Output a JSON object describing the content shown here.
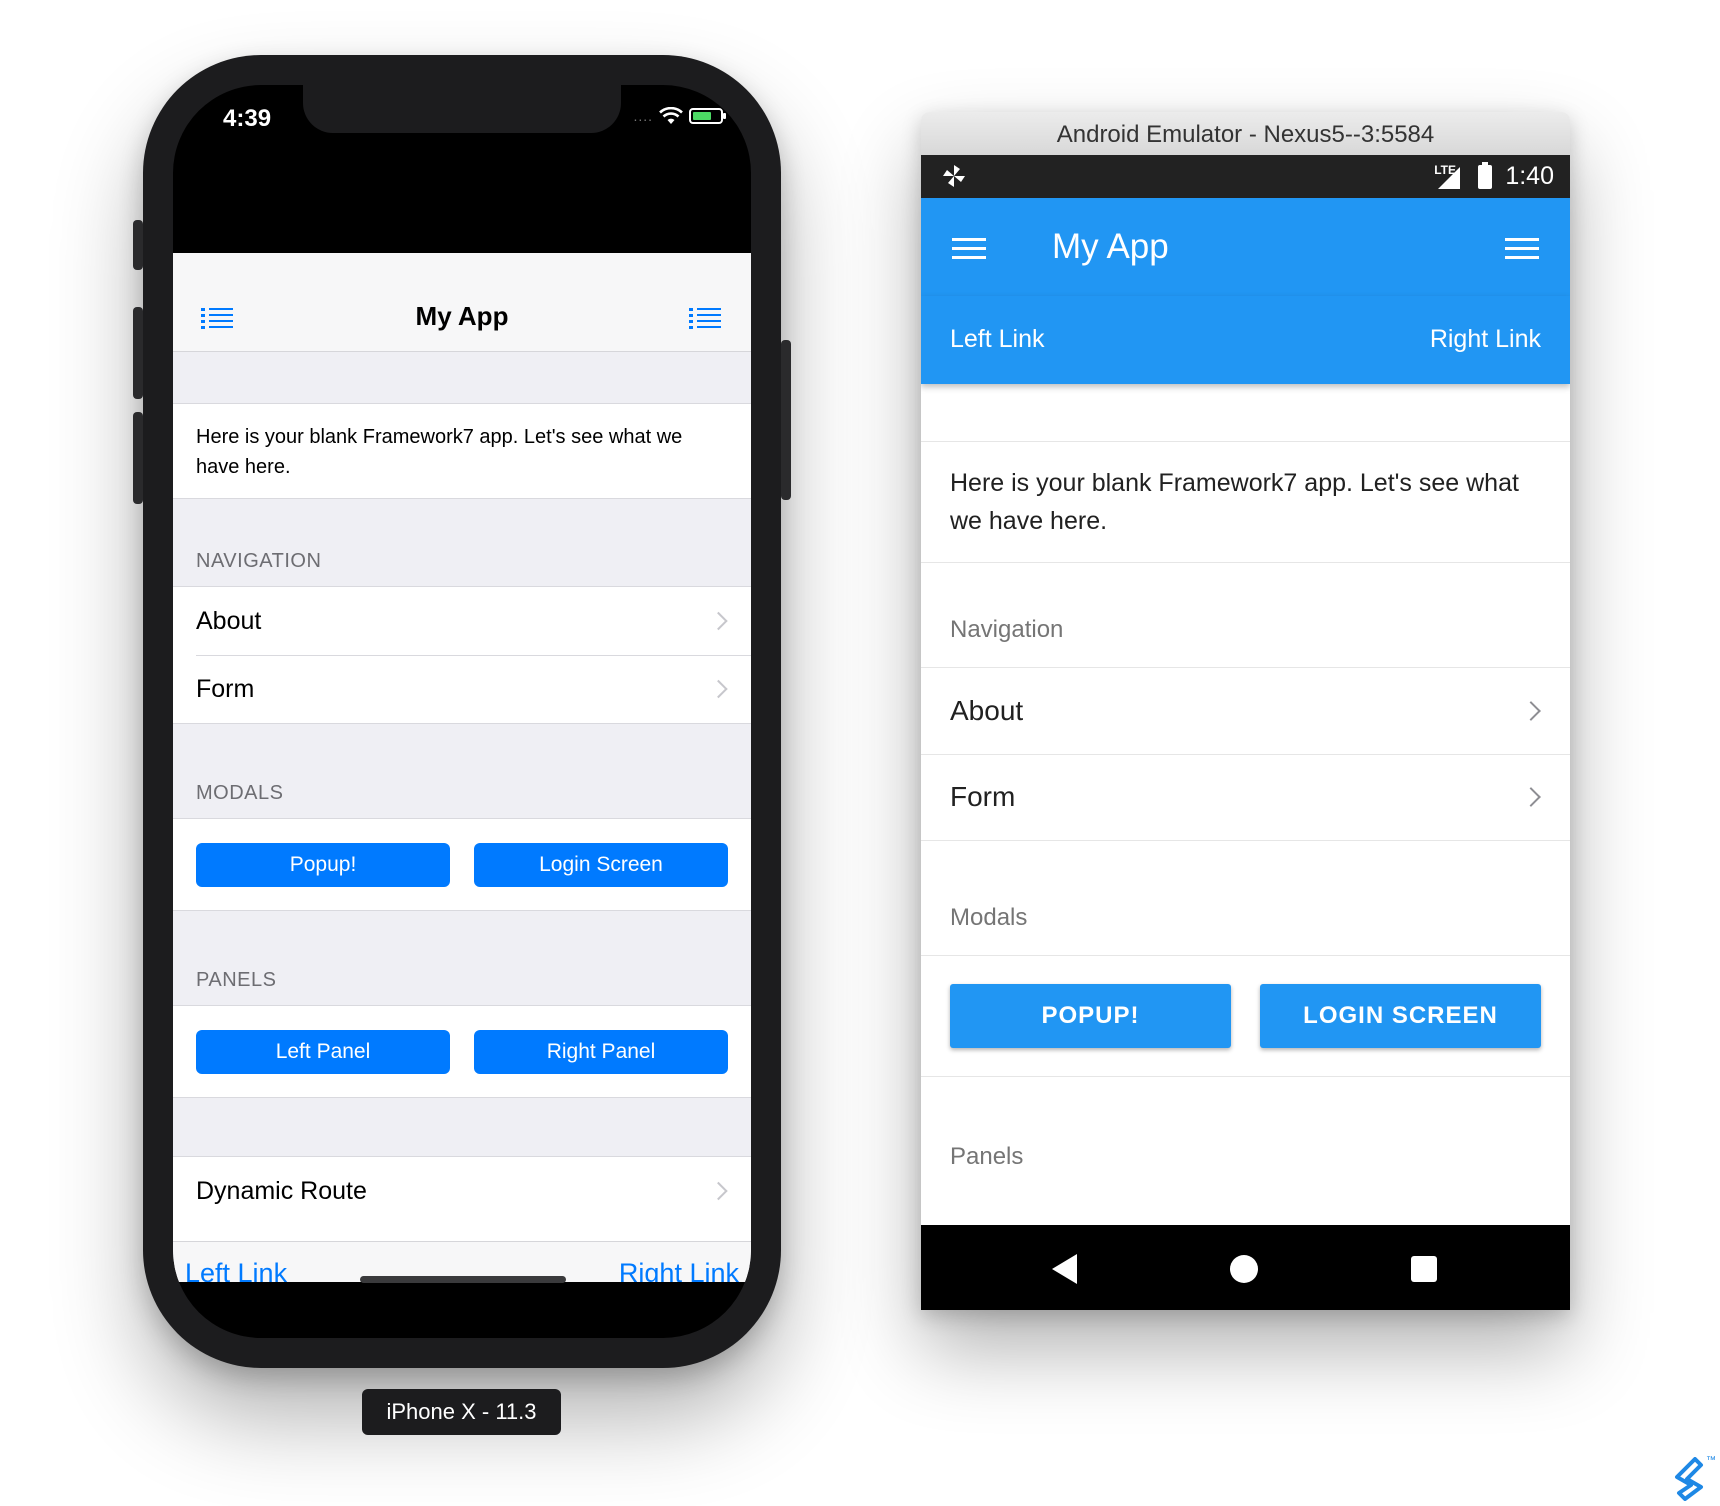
{
  "iphone": {
    "status_time": "4:39",
    "status_dots": "....",
    "device_label": "iPhone X - 11.3",
    "navbar": {
      "title": "My App",
      "left_icon": "list-icon",
      "right_icon": "list-icon"
    },
    "intro_text": "Here is your blank Framework7 app. Let's see what we have here.",
    "sections": {
      "navigation": "NAVIGATION",
      "modals": "MODALS",
      "panels": "PANELS"
    },
    "navigation_items": [
      "About",
      "Form"
    ],
    "modal_buttons": [
      "Popup!",
      "Login Screen"
    ],
    "panel_buttons": [
      "Left Panel",
      "Right Panel"
    ],
    "extra_item": "Dynamic Route",
    "toolbar": {
      "left_link": "Left Link",
      "right_link": "Right Link"
    }
  },
  "android": {
    "window_title": "Android Emulator - Nexus5--3:5584",
    "status_time": "1:40",
    "status_network": "LTE",
    "navbar": {
      "title": "My App",
      "left_icon": "menu-icon",
      "right_icon": "menu-icon"
    },
    "toolbar": {
      "left_link": "Left Link",
      "right_link": "Right Link"
    },
    "intro_text": "Here is your blank Framework7 app. Let's see what we have here.",
    "sections": {
      "navigation": "Navigation",
      "modals": "Modals",
      "panels": "Panels"
    },
    "navigation_items": [
      "About",
      "Form"
    ],
    "modal_buttons": [
      "POPUP!",
      "LOGIN SCREEN"
    ]
  },
  "colors": {
    "ios_accent": "#007aff",
    "android_primary": "#2196f3",
    "ios_background": "#efeff4"
  }
}
